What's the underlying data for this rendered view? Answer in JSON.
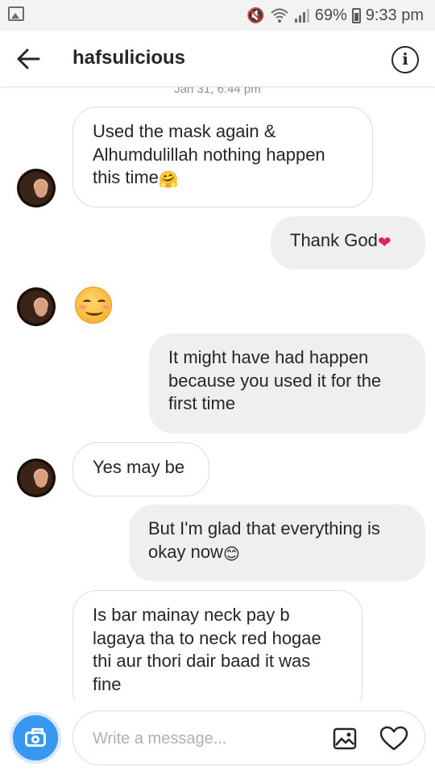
{
  "status_bar": {
    "battery": "69%",
    "time": "9:33 pm",
    "icons": [
      "gallery-icon",
      "mute-icon",
      "wifi-icon",
      "signal-icon",
      "battery-icon"
    ]
  },
  "header": {
    "username": "hafsulicious",
    "back_icon": "arrow-left-icon",
    "info_icon": "info-icon",
    "info_glyph": "i"
  },
  "timestamp": "Jan 31, 6:44 pm",
  "messages": [
    {
      "side": "received",
      "text": "Used the mask again &\nAlhumdulillah nothing happen\nthis time",
      "emoji": "🤗"
    },
    {
      "side": "sent",
      "text": "Thank God",
      "emoji": "❤"
    },
    {
      "side": "received",
      "emoji_only": "smiling-face-with-smiling-eyes"
    },
    {
      "side": "sent",
      "text": "It might have had happen\nbecause you used it for the\nfirst time"
    },
    {
      "side": "received",
      "text": "Yes may be"
    },
    {
      "side": "sent",
      "text": "But I'm glad that everything is\nokay now",
      "emoji": "😊"
    },
    {
      "side": "received",
      "text": "Is bar mainay neck pay b\nlagaya tha to neck red hogae\nthi aur thori dair baad it was\nfine"
    }
  ],
  "composer": {
    "placeholder": "Write a message...",
    "camera_icon": "camera-icon",
    "gallery_icon": "image-icon",
    "like_icon": "heart-icon"
  },
  "colors": {
    "accent": "#3897f0",
    "sent_bubble": "#efefef",
    "received_border": "#dbdbdb",
    "text": "#262626"
  }
}
